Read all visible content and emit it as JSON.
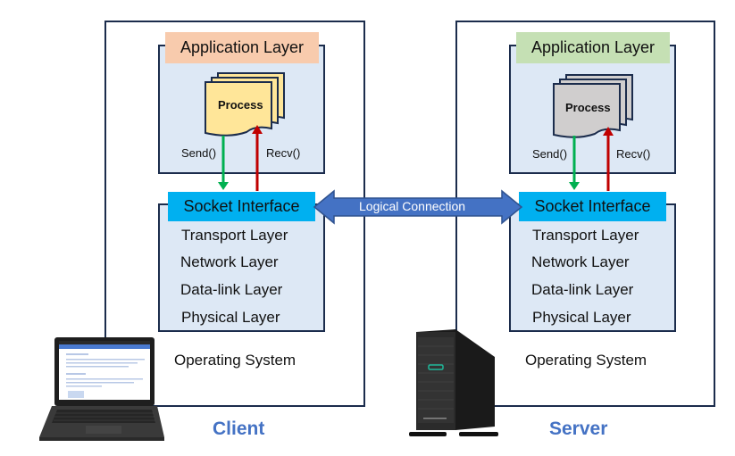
{
  "client": {
    "role_label": "Client",
    "app_layer": {
      "title": "Application Layer",
      "title_color": "#f8cbad"
    },
    "process": {
      "label": "Process",
      "fill": "#ffe699"
    },
    "send_label": "Send()",
    "recv_label": "Recv()",
    "socket_label": "Socket Interface",
    "layers": [
      "Transport Layer",
      "Network Layer",
      "Data-link Layer",
      "Physical Layer"
    ],
    "os_label": "Operating System",
    "device_icon": "laptop-icon"
  },
  "server": {
    "role_label": "Server",
    "app_layer": {
      "title": "Application Layer",
      "title_color": "#c5e0b4"
    },
    "process": {
      "label": "Process",
      "fill": "#d0cece"
    },
    "send_label": "Send()",
    "recv_label": "Recv()",
    "socket_label": "Socket Interface",
    "layers": [
      "Transport Layer",
      "Network Layer",
      "Data-link Layer",
      "Physical Layer"
    ],
    "os_label": "Operating System",
    "device_icon": "tower-server-icon"
  },
  "connection": {
    "label": "Logical Connection",
    "color": "#4472c4"
  },
  "colors": {
    "frame": "#1b2c4c",
    "layer_bg": "#dde8f5",
    "socket_bg": "#00b0f0",
    "send_arrow": "#00b050",
    "recv_arrow": "#c00000",
    "role_text": "#4472c4"
  }
}
